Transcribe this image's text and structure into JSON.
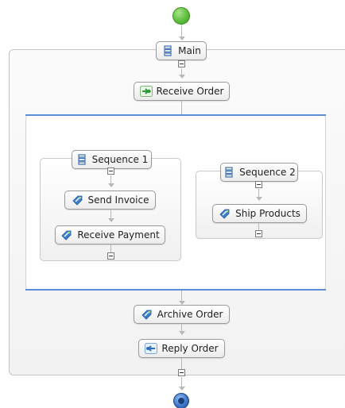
{
  "nodes": {
    "main": "Main",
    "receive_order": "Receive Order",
    "sequence1": "Sequence 1",
    "send_invoice": "Send Invoice",
    "receive_payment": "Receive Payment",
    "sequence2": "Sequence 2",
    "ship_products": "Ship Products",
    "archive_order": "Archive Order",
    "reply_order": "Reply Order"
  },
  "icons": {
    "sequence": "sequence-icon",
    "receive": "receive-icon",
    "invoke": "invoke-icon",
    "reply": "reply-icon"
  },
  "colors": {
    "start": "#5fbf3f",
    "end": "#2f66b3",
    "flow_bar": "#5b8ed6",
    "receive_icon": "#2e9a36",
    "invoke_icon": "#3b7fd0"
  }
}
